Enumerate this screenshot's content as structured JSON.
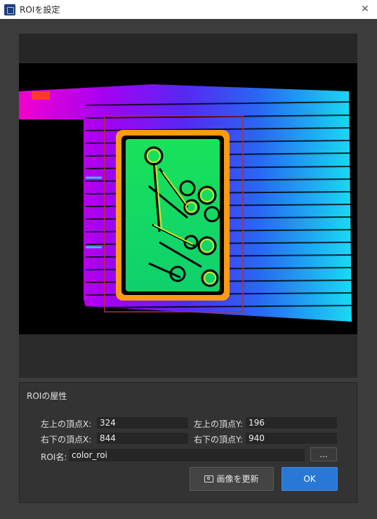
{
  "window": {
    "title": "ROIを設定",
    "close_glyph": "✕"
  },
  "properties": {
    "heading": "ROIの屋性",
    "top_left_x_label": "左上の頂点X:",
    "top_left_x_value": "324",
    "top_left_y_label": "左上の頂点Y:",
    "top_left_y_value": "196",
    "bottom_right_x_label": "右下の頂点X:",
    "bottom_right_x_value": "844",
    "bottom_right_y_label": "右下の頂点Y:",
    "bottom_right_y_value": "940",
    "roi_name_label": "ROI名:",
    "roi_name_value": "color_roi",
    "browse_label": "..."
  },
  "buttons": {
    "update_image": "画像を更新",
    "ok": "OK"
  },
  "icons": {
    "app": "app-icon",
    "camera": "camera-icon",
    "close": "close-icon"
  },
  "colors": {
    "accent": "#2a78d6",
    "roi_rect": "#c0282c"
  }
}
